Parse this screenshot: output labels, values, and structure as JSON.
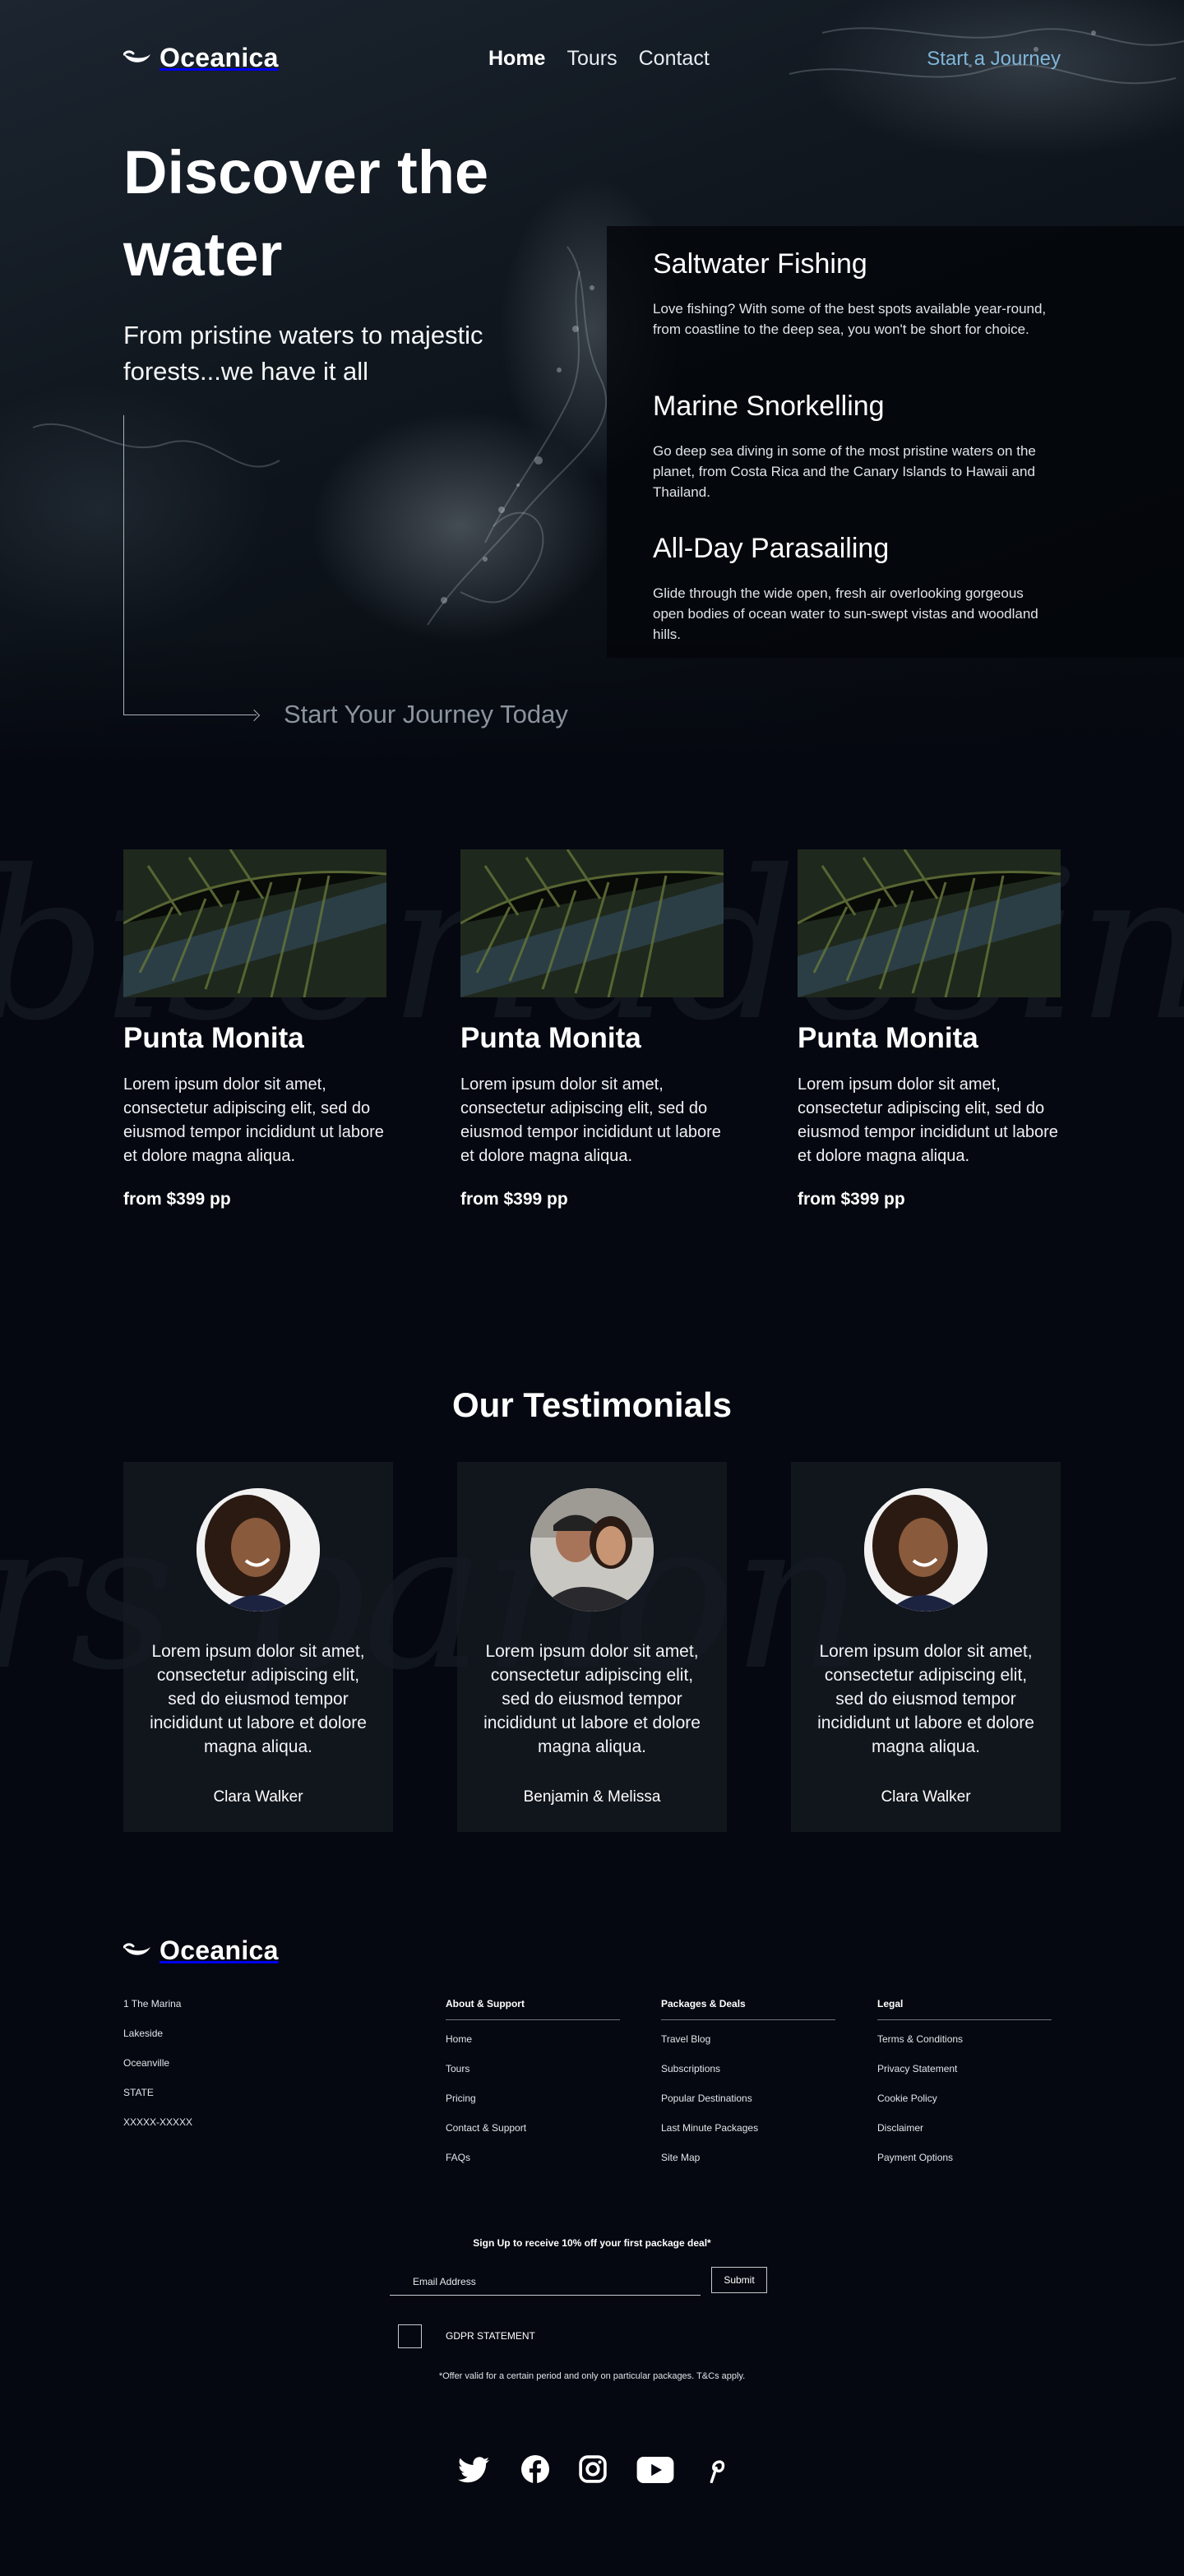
{
  "brand": {
    "name": "Oceanica",
    "accent": "#7fb6d9"
  },
  "nav": {
    "links": [
      "Home",
      "Tours",
      "Contact"
    ],
    "active": "Home",
    "cta": "Start a Journey"
  },
  "hero": {
    "title": "Discover the water",
    "subtitle": "From pristine waters to majestic forests...we have it all",
    "cta": "Start Your Journey Today"
  },
  "features": [
    {
      "title": "Saltwater Fishing",
      "text": "Love fishing? With some of the best spots available year-round, from coastline to the deep sea, you won't be short for choice."
    },
    {
      "title": "Marine Snorkelling",
      "text": "Go deep sea diving in some of the most pristine waters on the planet, from Costa Rica and the Canary Islands to Hawaii and Thailand."
    },
    {
      "title": "All-Day Parasailing",
      "text": "Glide through the wide open, fresh air overlooking gorgeous open bodies of ocean water to sun-swept vistas and woodland hills."
    }
  ],
  "tours": {
    "background_script": "bisoriadesinat",
    "items": [
      {
        "title": "Punta Monita",
        "desc": "Lorem ipsum dolor sit amet, consectetur adipiscing elit, sed do eiusmod tempor incididunt ut labore et dolore magna aliqua.",
        "price": "from $399 pp"
      },
      {
        "title": "Punta Monita",
        "desc": "Lorem ipsum dolor sit amet, consectetur adipiscing elit, sed do eiusmod tempor incididunt ut labore et dolore magna aliqua.",
        "price": "from $399 pp"
      },
      {
        "title": "Punta Monita",
        "desc": "Lorem ipsum dolor sit amet, consectetur adipiscing elit, sed do eiusmod tempor incididunt ut labore et dolore magna aliqua.",
        "price": "from $399 pp"
      }
    ]
  },
  "testimonials": {
    "heading": "Our Testimonials",
    "background_script": "rs panon",
    "items": [
      {
        "text": "Lorem ipsum dolor sit amet, consectetur adipiscing elit, sed do eiusmod tempor incididunt ut labore et dolore magna aliqua.",
        "name": "Clara Walker"
      },
      {
        "text": "Lorem ipsum dolor sit amet, consectetur adipiscing elit, sed do eiusmod tempor incididunt ut labore et dolore magna aliqua.",
        "name": "Benjamin & Melissa"
      },
      {
        "text": "Lorem ipsum dolor sit amet, consectetur adipiscing elit, sed do eiusmod tempor incididunt ut labore et dolore magna aliqua.",
        "name": "Clara Walker"
      }
    ]
  },
  "footer": {
    "address": [
      "1 The Marina",
      "Lakeside",
      "Oceanville",
      "STATE",
      "XXXXX-XXXXX"
    ],
    "columns": [
      {
        "heading": "About & Support",
        "links": [
          "Home",
          "Tours",
          "Pricing",
          "Contact & Support",
          "FAQs"
        ]
      },
      {
        "heading": "Packages & Deals",
        "links": [
          "Travel Blog",
          "Subscriptions",
          "Popular Destinations",
          "Last Minute Packages",
          "Site Map"
        ]
      },
      {
        "heading": "Legal",
        "links": [
          "Terms & Conditions",
          "Privacy Statement",
          "Cookie Policy",
          "Disclaimer",
          "Payment Options"
        ]
      }
    ],
    "signup": {
      "label": "Sign Up to receive 10% off your first package deal*",
      "placeholder": "Email Address",
      "submit": "Submit",
      "gdpr": "GDPR STATEMENT",
      "disclaimer": "*Offer valid for a certain period and only on particular packages. T&Cs apply."
    },
    "socials": [
      "twitter-icon",
      "facebook-icon",
      "instagram-icon",
      "youtube-icon",
      "pinterest-icon"
    ]
  }
}
